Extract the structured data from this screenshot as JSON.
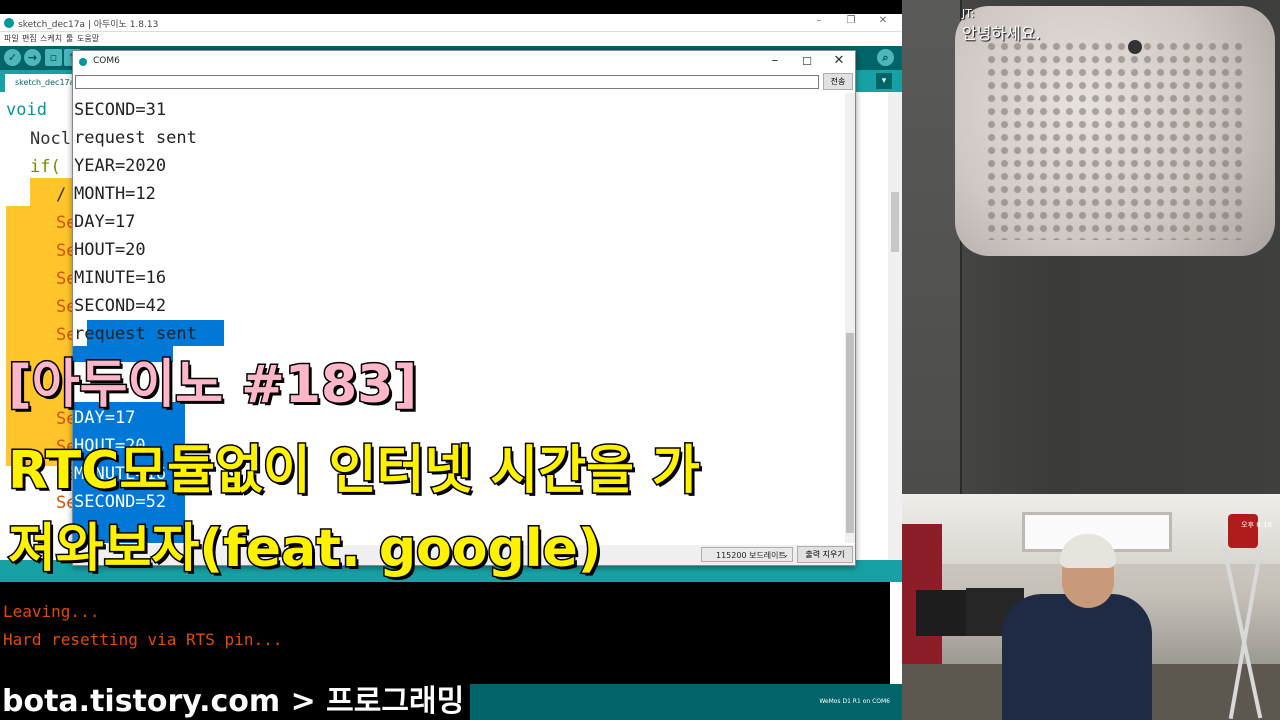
{
  "ide": {
    "title": "sketch_dec17a | 아두이노 1.8.13",
    "menu": [
      "파일",
      "편집",
      "스케치",
      "툴",
      "도움말"
    ],
    "tab_label": "sketch_dec17a",
    "code_lines": [
      "void",
      "Nocl",
      "if(",
      "/",
      "Se",
      "Se",
      "Se",
      "Se",
      "Se",
      "Se",
      "Se",
      "Se",
      "Se"
    ],
    "console_lines": [
      "Leaving...",
      "Hard resetting via RTS pin..."
    ],
    "board_status": "WeMos D1 R1 on COM6",
    "clock": "오후 8:16",
    "accent": "#00979c"
  },
  "serial_monitor": {
    "title": "COM6",
    "send_label": "전송",
    "input_value": "",
    "lines": [
      "SECOND=31",
      "request sent",
      "YEAR=2020",
      "MONTH=12",
      "DAY=17",
      "HOUT=20",
      "MINUTE=16",
      "SECOND=42",
      "request sent",
      "",
      "DAY=17",
      "HOUT=20",
      "MINUTE=16",
      "SECOND=52"
    ],
    "baud": "115200 보드레이트",
    "clear_label": "출력 지우기",
    "selection_color": "#0078d7"
  },
  "overlay": {
    "line1": "[아두이노 #183]",
    "line2": "RTC모듈없이 인터넷 시간을 가",
    "line3": "져와보자(feat. google)",
    "site": "bota.tistory.com > 프로그래밍"
  },
  "stream": {
    "chat_user": "JT:",
    "chat_message": "안녕하세요."
  }
}
